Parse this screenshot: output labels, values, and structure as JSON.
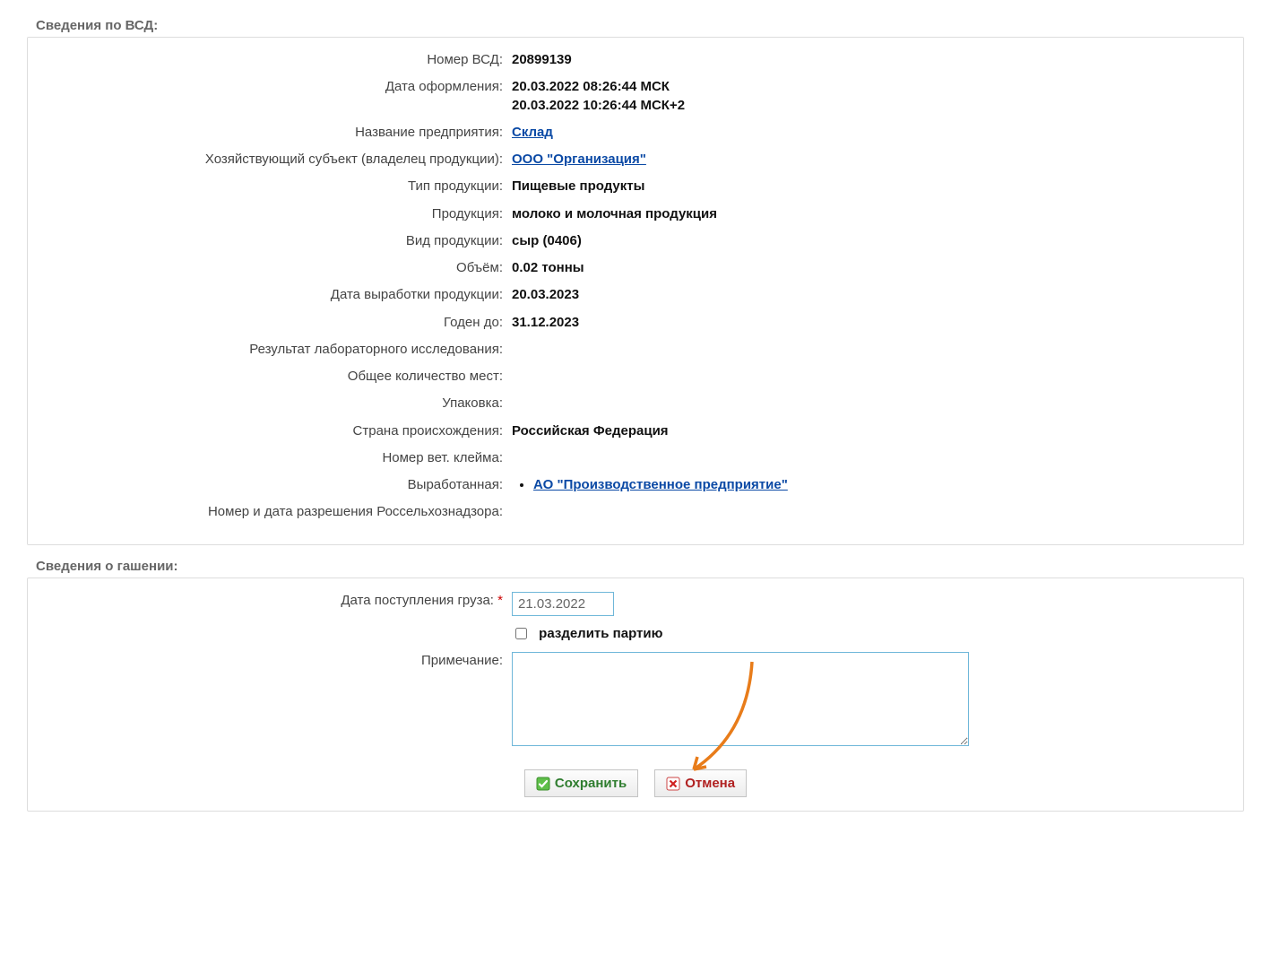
{
  "section1": {
    "title": "Сведения по ВСД:",
    "rows": {
      "vsd_number_label": "Номер ВСД:",
      "vsd_number": "20899139",
      "issue_date_label": "Дата оформления:",
      "issue_date_line1": "20.03.2022 08:26:44 МСК",
      "issue_date_line2": "20.03.2022 10:26:44 МСК+2",
      "enterprise_label": "Название предприятия:",
      "enterprise_link": "Склад",
      "owner_label": "Хозяйствующий субъект (владелец продукции):",
      "owner_link": "ООО \"Организация\"",
      "prod_type_label": "Тип продукции:",
      "prod_type": "Пищевые продукты",
      "product_label": "Продукция:",
      "product": "молоко и молочная продукция",
      "product_kind_label": "Вид продукции:",
      "product_kind": "сыр (0406)",
      "volume_label": "Объём:",
      "volume": "0.02 тонны",
      "made_date_label": "Дата выработки продукции:",
      "made_date": "20.03.2023",
      "expiry_label": "Годен до:",
      "expiry": "31.12.2023",
      "lab_label": "Результат лабораторного исследования:",
      "places_label": "Общее количество мест:",
      "packaging_label": "Упаковка:",
      "origin_label": "Страна происхождения:",
      "origin": "Российская Федерация",
      "stamp_label": "Номер вет. клейма:",
      "produced_by_label": "Выработанная:",
      "produced_by_link": "АО \"Производственное предприятие\"",
      "permit_label": "Номер и дата разрешения Россельхознадзора:"
    }
  },
  "section2": {
    "title": "Сведения о гашении:",
    "arrival_label": "Дата поступления груза:",
    "arrival_value": "21.03.2022",
    "split_label": "разделить партию",
    "note_label": "Примечание:"
  },
  "buttons": {
    "save": "Сохранить",
    "cancel": "Отмена"
  }
}
